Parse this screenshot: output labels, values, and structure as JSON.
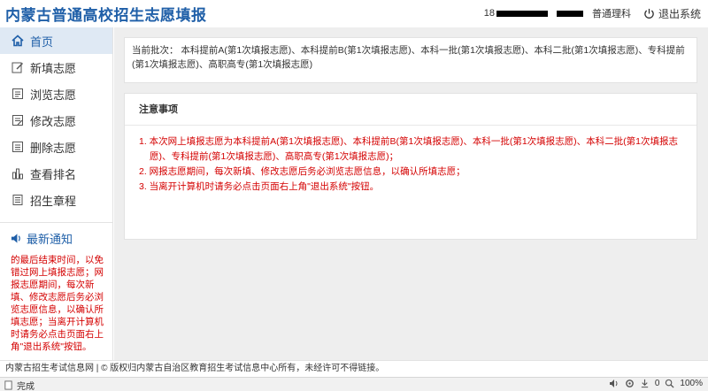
{
  "header": {
    "title": "内蒙古普通高校招生志愿填报",
    "phone_prefix": "18",
    "category": "普通理科",
    "logout_label": "退出系统"
  },
  "sidebar": {
    "items": [
      {
        "label": "首页",
        "icon": "home-icon",
        "active": true
      },
      {
        "label": "新填志愿",
        "icon": "edit-icon"
      },
      {
        "label": "浏览志愿",
        "icon": "list-icon"
      },
      {
        "label": "修改志愿",
        "icon": "modify-icon"
      },
      {
        "label": "删除志愿",
        "icon": "delete-icon"
      },
      {
        "label": "查看排名",
        "icon": "ranking-icon"
      },
      {
        "label": "招生章程",
        "icon": "charter-icon"
      }
    ],
    "notice_title": "最新通知",
    "notice_text": "的最后结束时间，以免错过网上填报志愿；网报志愿期间，每次新填、修改志愿后务必浏览志愿信息，以确认所填志愿；当离开计算机时请务必点击页面右上角\"退出系统\"按钮。"
  },
  "main": {
    "batch_label": "当前批次：",
    "batch_text": "本科提前A(第1次填报志愿)、本科提前B(第1次填报志愿)、本科一批(第1次填报志愿)、本科二批(第1次填报志愿)、专科提前(第1次填报志愿)、高职高专(第1次填报志愿)",
    "notes_title": "注意事项",
    "notes": [
      "1. 本次网上填报志愿为本科提前A(第1次填报志愿)、本科提前B(第1次填报志愿)、本科一批(第1次填报志愿)、本科二批(第1次填报志愿)、专科提前(第1次填报志愿)、高职高专(第1次填报志愿)；",
      "2. 网报志愿期间，每次新填、修改志愿后务必浏览志愿信息，以确认所填志愿；",
      "3. 当离开计算机时请务必点击页面右上角\"退出系统\"按钮。"
    ]
  },
  "footer": {
    "site_link": "内蒙古招生考试信息网",
    "copyright": "| © 版权归内蒙古自治区教育招生考试信息中心所有，未经许可不得链接。"
  },
  "statusbar": {
    "status": "完成",
    "count": "0",
    "zoom": "100%"
  },
  "colors": {
    "brand": "#1f5fa8",
    "alert": "#d40000",
    "active_bg": "#dfe9f4"
  }
}
